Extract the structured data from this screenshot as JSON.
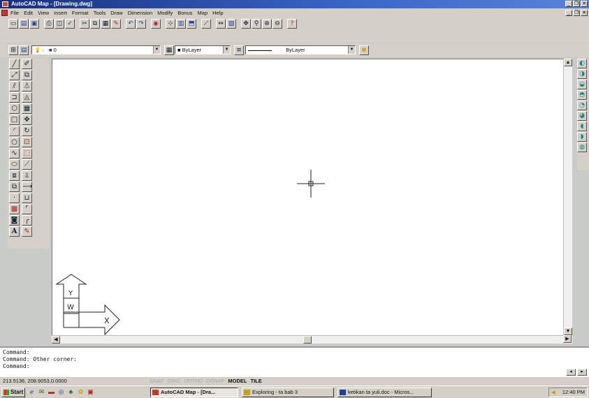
{
  "window": {
    "title": "AutoCAD Map - [Drawing.dwg]",
    "controls": [
      "_",
      "❐",
      "✕"
    ]
  },
  "menu": {
    "items": [
      "File",
      "Edit",
      "View",
      "Insert",
      "Format",
      "Tools",
      "Draw",
      "Dimension",
      "Modify",
      "Bonus",
      "Map",
      "Help"
    ],
    "doc_controls": [
      "_",
      "❐",
      "✕"
    ]
  },
  "layers": {
    "layer_value": "0",
    "color_value": "ByLayer",
    "linetype_value": "ByLayer"
  },
  "command": {
    "lines": [
      "Command:",
      "Command: Other corner:",
      "Command:"
    ]
  },
  "status": {
    "coords": "213.5136, 208.9053,0.0000",
    "modes_off": [
      "SNAP",
      "GRID",
      "ORTHO",
      "OSNAP"
    ],
    "model_label": "MODEL",
    "tile_label": "TILE"
  },
  "taskbar": {
    "start_label": "Start",
    "tasks": [
      "AutoCAD Map - [Dra...",
      "Exploring - ta bab 3",
      "ketikan ta yuli.doc - Micros..."
    ],
    "clock": "12:40 PM"
  },
  "ucs": {
    "y_label": "Y",
    "w_label": "W",
    "x_label": "X"
  },
  "colors": {
    "title_bar": "#18307e",
    "drawing_bg": "#ffffff",
    "chrome": "#d4d0c8"
  }
}
